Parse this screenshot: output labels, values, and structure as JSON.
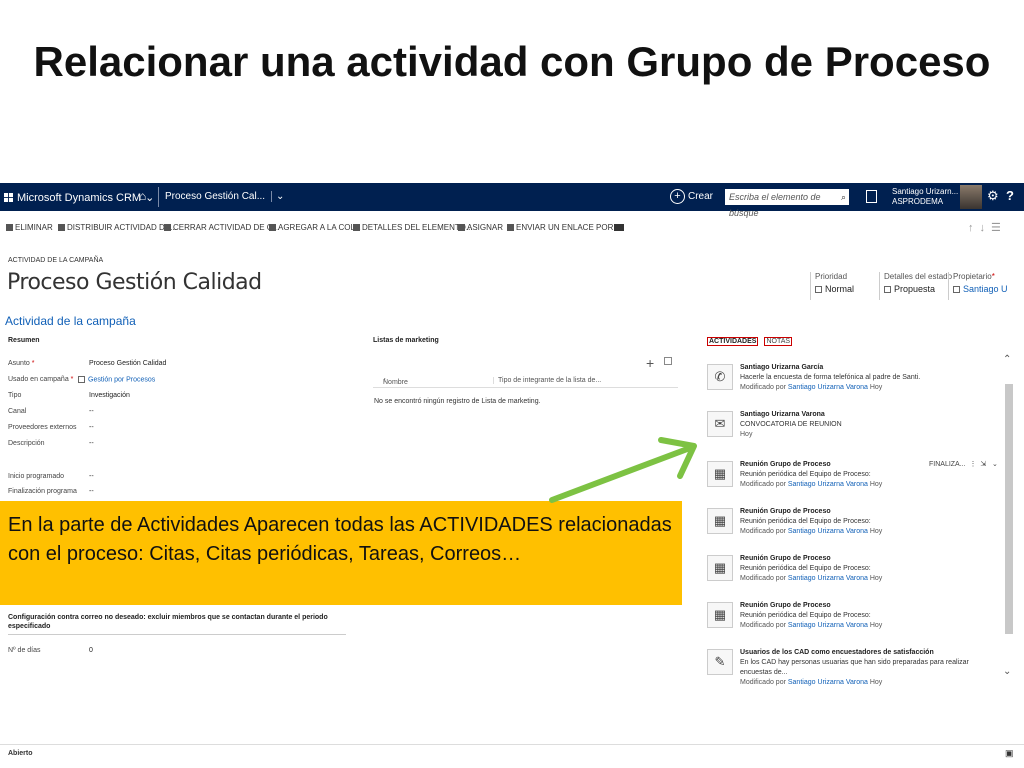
{
  "slide": {
    "title": "Relacionar una actividad con Grupo de Proceso"
  },
  "nav": {
    "brand": "Microsoft Dynamics CRM",
    "breadcrumb": "Proceso Gestión Cal...",
    "create_label": "Crear",
    "search_placeholder": "Escriba el elemento de búsque",
    "user_name": "Santiago Urizarn...",
    "user_org": "ASPRODEMA",
    "help_label": "?"
  },
  "commands": [
    "ELIMINAR",
    "DISTRIBUIR ACTIVIDAD DE...",
    "CERRAR ACTIVIDAD DE C...",
    "AGREGAR A LA COLA",
    "DETALLES DEL ELEMENTO...",
    "ASIGNAR",
    "ENVIAR UN ENLACE POR..."
  ],
  "record": {
    "entity_type": "ACTIVIDAD DE LA CAMPAÑA",
    "title": "Proceso Gestión Calidad",
    "section_title": "Actividad de la campaña",
    "header_fields": [
      {
        "label": "Prioridad",
        "value": "Normal"
      },
      {
        "label": "Detalles del estado",
        "value": "Propuesta"
      },
      {
        "label": "Propietario",
        "value": "Santiago U"
      }
    ]
  },
  "summary": {
    "heading": "Resumen",
    "fields": [
      {
        "label": "Asunto",
        "value": "Proceso Gestión Calidad",
        "required": "*"
      },
      {
        "label": "Usado en campaña",
        "value": "Gestión por Procesos",
        "required": "*"
      },
      {
        "label": "Tipo",
        "value": "Investigación"
      },
      {
        "label": "Canal",
        "value": "--"
      },
      {
        "label": "Proveedores externos",
        "value": "--"
      },
      {
        "label": "Descripción",
        "value": "--"
      },
      {
        "label": "Inicio programado",
        "value": "--"
      },
      {
        "label": "Finalización programa",
        "value": "--"
      }
    ]
  },
  "marketing": {
    "heading": "Listas de marketing",
    "col_name": "Nombre",
    "col_type": "Tipo de integrante de la lista de...",
    "empty": "No se encontró ningún registro de Lista de marketing."
  },
  "config": {
    "heading": "Configuración contra correo no deseado: excluir miembros que se contactan durante el periodo especificado",
    "days_label": "Nº de días",
    "days_value": "0"
  },
  "activities": {
    "tab_activities": "ACTIVIDADES",
    "tab_notes": "NOTAS",
    "extra_label": "FINALIZA...",
    "items": [
      {
        "title": "Santiago Urizarna García",
        "desc": "Hacerle la encuesta de forma telefónica al padre de Santi.",
        "mod": "Modificado por",
        "by": "Santiago Urizarna Varona",
        "when": "Hoy"
      },
      {
        "title": "Santiago Urizarna Varona",
        "desc": "CONVOCATORIA DE REUNION",
        "mod": "",
        "by": "",
        "when": "Hoy"
      },
      {
        "title": "Reunión Grupo de Proceso",
        "desc": "Reunión periódica del Equipo de Proceso:",
        "mod": "Modificado por",
        "by": "Santiago Urizarna Varona",
        "when": "Hoy"
      },
      {
        "title": "Reunión Grupo de Proceso",
        "desc": "Reunión periódica del Equipo de Proceso:",
        "mod": "Modificado por",
        "by": "Santiago Urizarna Varona",
        "when": "Hoy"
      },
      {
        "title": "Reunión Grupo de Proceso",
        "desc": "Reunión periódica del Equipo de Proceso:",
        "mod": "Modificado por",
        "by": "Santiago Urizarna Varona",
        "when": "Hoy"
      },
      {
        "title": "Reunión Grupo de Proceso",
        "desc": "Reunión periódica del Equipo de Proceso:",
        "mod": "Modificado por",
        "by": "Santiago Urizarna Varona",
        "when": "Hoy"
      },
      {
        "title": "Usuarios de los CAD como encuestadores de satisfacción",
        "desc": "En los CAD hay personas usuarias que han sido preparadas para realizar encuestas de...",
        "mod": "Modificado por",
        "by": "Santiago Urizarna Varona",
        "when": "Hoy"
      }
    ]
  },
  "status": {
    "state": "Abierto"
  },
  "callout": {
    "text": "En la parte de Actividades Aparecen todas las ACTIVIDADES relacionadas con el proceso: Citas, Citas periódicas, Tareas, Correos…"
  },
  "colors": {
    "nav": "#002050",
    "link": "#1160b7",
    "callout": "#ffc000",
    "arrow": "#7dc243"
  }
}
